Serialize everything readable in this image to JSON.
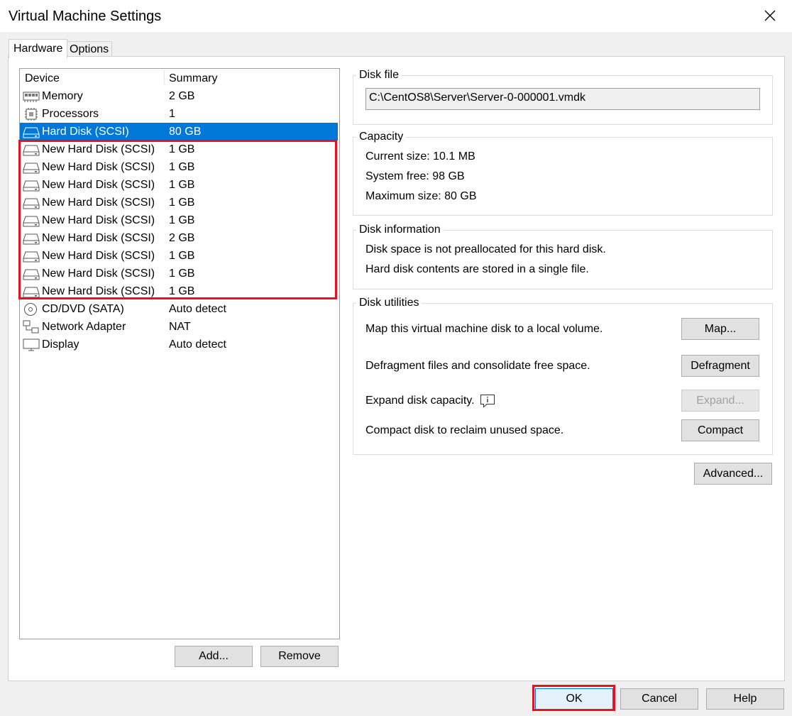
{
  "window": {
    "title": "Virtual Machine Settings",
    "close_icon": "close-icon"
  },
  "tabs": [
    {
      "label": "Hardware"
    },
    {
      "label": "Options"
    }
  ],
  "device_list": {
    "col_device": "Device",
    "col_summary": "Summary",
    "rows": [
      {
        "name": "Memory",
        "summary": "2 GB",
        "icon": "memory-icon"
      },
      {
        "name": "Processors",
        "summary": "1",
        "icon": "processor-icon"
      },
      {
        "name": "Hard Disk (SCSI)",
        "summary": "80 GB",
        "icon": "hard-disk-icon",
        "selected": true
      },
      {
        "name": "New Hard Disk (SCSI)",
        "summary": "1 GB",
        "icon": "hard-disk-icon"
      },
      {
        "name": "New Hard Disk (SCSI)",
        "summary": "1 GB",
        "icon": "hard-disk-icon"
      },
      {
        "name": "New Hard Disk (SCSI)",
        "summary": "1 GB",
        "icon": "hard-disk-icon"
      },
      {
        "name": "New Hard Disk (SCSI)",
        "summary": "1 GB",
        "icon": "hard-disk-icon"
      },
      {
        "name": "New Hard Disk (SCSI)",
        "summary": "1 GB",
        "icon": "hard-disk-icon"
      },
      {
        "name": "New Hard Disk (SCSI)",
        "summary": "2 GB",
        "icon": "hard-disk-icon"
      },
      {
        "name": "New Hard Disk (SCSI)",
        "summary": "1 GB",
        "icon": "hard-disk-icon"
      },
      {
        "name": "New Hard Disk (SCSI)",
        "summary": "1 GB",
        "icon": "hard-disk-icon"
      },
      {
        "name": "New Hard Disk (SCSI)",
        "summary": "1 GB",
        "icon": "hard-disk-icon"
      },
      {
        "name": "CD/DVD (SATA)",
        "summary": "Auto detect",
        "icon": "cd-dvd-icon"
      },
      {
        "name": "Network Adapter",
        "summary": "NAT",
        "icon": "network-adapter-icon"
      },
      {
        "name": "Display",
        "summary": "Auto detect",
        "icon": "display-icon"
      }
    ],
    "add_button": "Add...",
    "remove_button": "Remove"
  },
  "disk_file": {
    "label": "Disk file",
    "path": "C:\\CentOS8\\Server\\Server-0-000001.vmdk"
  },
  "capacity": {
    "label": "Capacity",
    "current_size_label": "Current size:",
    "current_size": "10.1 MB",
    "system_free_label": "System free:",
    "system_free": "98 GB",
    "maximum_size_label": "Maximum size:",
    "maximum_size": "80 GB"
  },
  "disk_information": {
    "label": "Disk information",
    "line1": "Disk space is not preallocated for this hard disk.",
    "line2": "Hard disk contents are stored in a single file."
  },
  "disk_utilities": {
    "label": "Disk utilities",
    "map_text": "Map this virtual machine disk to a local volume.",
    "map_button": "Map...",
    "defrag_text": "Defragment files and consolidate free space.",
    "defrag_button": "Defragment",
    "expand_text": "Expand disk capacity.",
    "expand_button": "Expand...",
    "compact_text": "Compact disk to reclaim unused space.",
    "compact_button": "Compact"
  },
  "advanced_button": "Advanced...",
  "footer": {
    "ok": "OK",
    "cancel": "Cancel",
    "help": "Help"
  },
  "colors": {
    "selection": "#0078d7",
    "highlight_box": "#e81123"
  }
}
